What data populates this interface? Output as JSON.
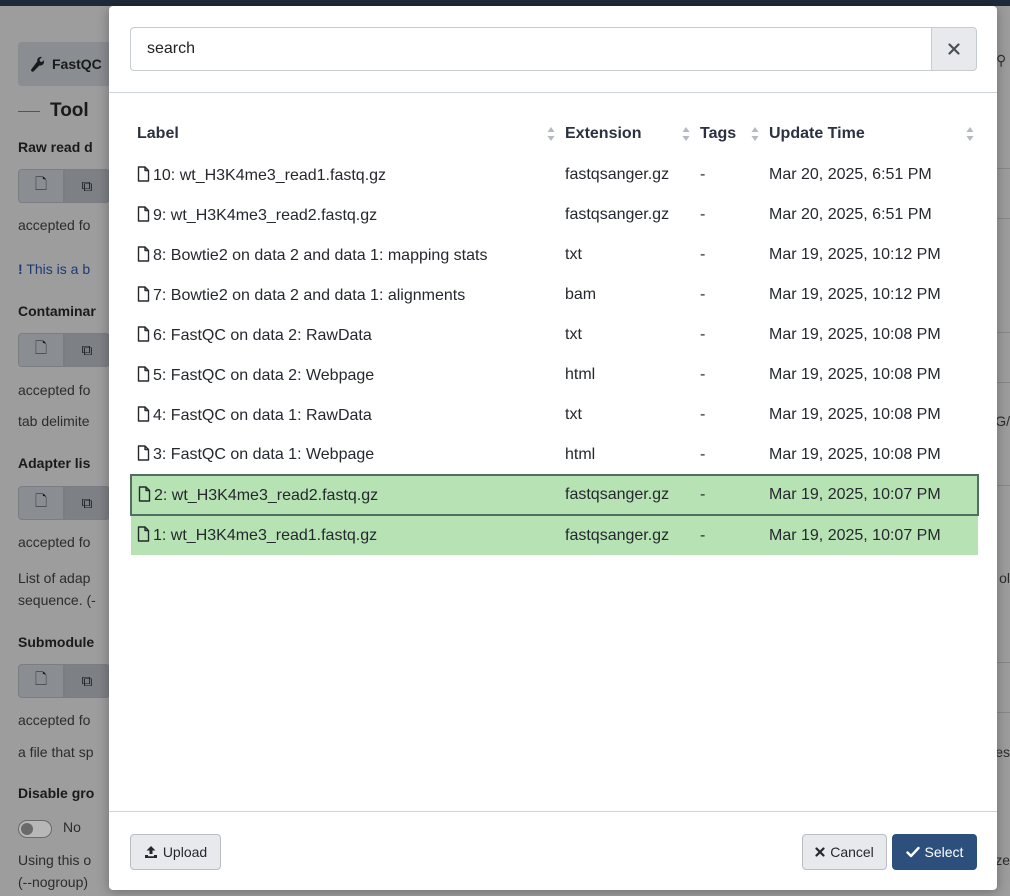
{
  "background": {
    "tool_button_label": "FastQC",
    "tool_heading": "Tool",
    "sections": [
      {
        "label": "Raw read d",
        "accepted": "accepted fo",
        "note": "This is a b"
      },
      {
        "label": "Contaminar",
        "accepted": "accepted fo",
        "note": "tab delimite"
      },
      {
        "label": "Adapter lis",
        "accepted": "accepted fo",
        "note": "List of adap",
        "note2": "sequence. (-"
      },
      {
        "label": "Submodule",
        "accepted": "accepted fo",
        "note": "a file that sp"
      },
      {
        "label": "Disable gro",
        "toggle_label": "No",
        "note": "Using this o",
        "note2": "(--nogroup)"
      }
    ],
    "right_edge": [
      "G/",
      "ol",
      "es",
      "ze"
    ]
  },
  "modal": {
    "search": {
      "placeholder": "search"
    },
    "columns": [
      "Label",
      "Extension",
      "Tags",
      "Update Time"
    ],
    "rows": [
      {
        "label": "10: wt_H3K4me3_read1.fastq.gz",
        "extension": "fastqsanger.gz",
        "tags": "-",
        "updated": "Mar 20, 2025, 6:51 PM",
        "state": "normal"
      },
      {
        "label": "9: wt_H3K4me3_read2.fastq.gz",
        "extension": "fastqsanger.gz",
        "tags": "-",
        "updated": "Mar 20, 2025, 6:51 PM",
        "state": "normal"
      },
      {
        "label": "8: Bowtie2 on data 2 and data 1: mapping stats",
        "extension": "txt",
        "tags": "-",
        "updated": "Mar 19, 2025, 10:12 PM",
        "state": "normal"
      },
      {
        "label": "7: Bowtie2 on data 2 and data 1: alignments",
        "extension": "bam",
        "tags": "-",
        "updated": "Mar 19, 2025, 10:12 PM",
        "state": "normal"
      },
      {
        "label": "6: FastQC on data 2: RawData",
        "extension": "txt",
        "tags": "-",
        "updated": "Mar 19, 2025, 10:08 PM",
        "state": "normal"
      },
      {
        "label": "5: FastQC on data 2: Webpage",
        "extension": "html",
        "tags": "-",
        "updated": "Mar 19, 2025, 10:08 PM",
        "state": "normal"
      },
      {
        "label": "4: FastQC on data 1: RawData",
        "extension": "txt",
        "tags": "-",
        "updated": "Mar 19, 2025, 10:08 PM",
        "state": "normal"
      },
      {
        "label": "3: FastQC on data 1: Webpage",
        "extension": "html",
        "tags": "-",
        "updated": "Mar 19, 2025, 10:08 PM",
        "state": "normal"
      },
      {
        "label": "2: wt_H3K4me3_read2.fastq.gz",
        "extension": "fastqsanger.gz",
        "tags": "-",
        "updated": "Mar 19, 2025, 10:07 PM",
        "state": "selected-focused"
      },
      {
        "label": "1: wt_H3K4me3_read1.fastq.gz",
        "extension": "fastqsanger.gz",
        "tags": "-",
        "updated": "Mar 19, 2025, 10:07 PM",
        "state": "selected"
      }
    ],
    "footer": {
      "upload_label": "Upload",
      "cancel_label": "Cancel",
      "select_label": "Select"
    },
    "colors": {
      "selected_row": "#b7e3b4",
      "primary": "#2c4f7c"
    }
  }
}
